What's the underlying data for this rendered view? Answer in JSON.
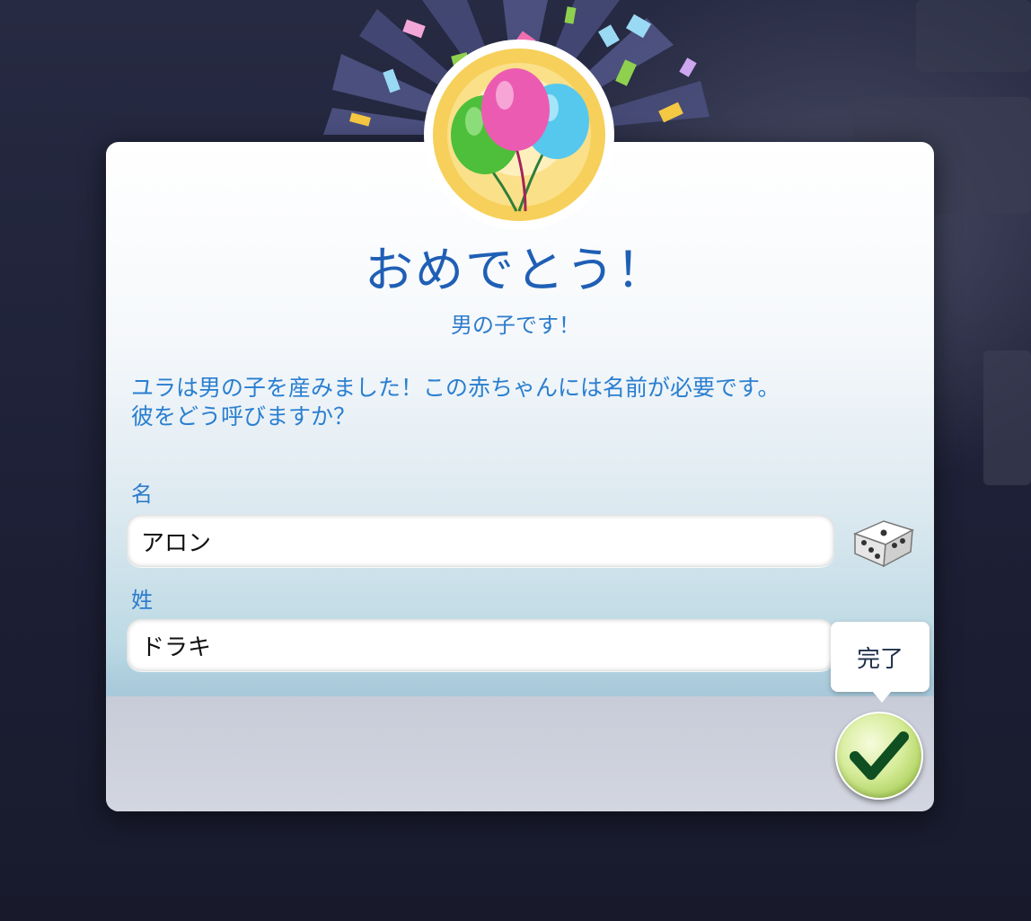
{
  "dialog": {
    "title": "おめでとう！",
    "subtitle": "男の子です！",
    "message_line1": "ユラは男の子を産みました！この赤ちゃんには名前が必要です。",
    "message_line2": "彼をどう呼びますか？"
  },
  "first_name": {
    "label": "名",
    "value": "アロン"
  },
  "last_name": {
    "label": "姓",
    "value": "ドラキ"
  },
  "done": {
    "tooltip": "完了"
  },
  "icons": {
    "badge": "balloons-icon",
    "randomize": "dice-icon",
    "confirm": "checkmark-icon"
  },
  "colors": {
    "title": "#1f5fb5",
    "text": "#2a7fd0",
    "confirm_green": "#a9cf59"
  }
}
